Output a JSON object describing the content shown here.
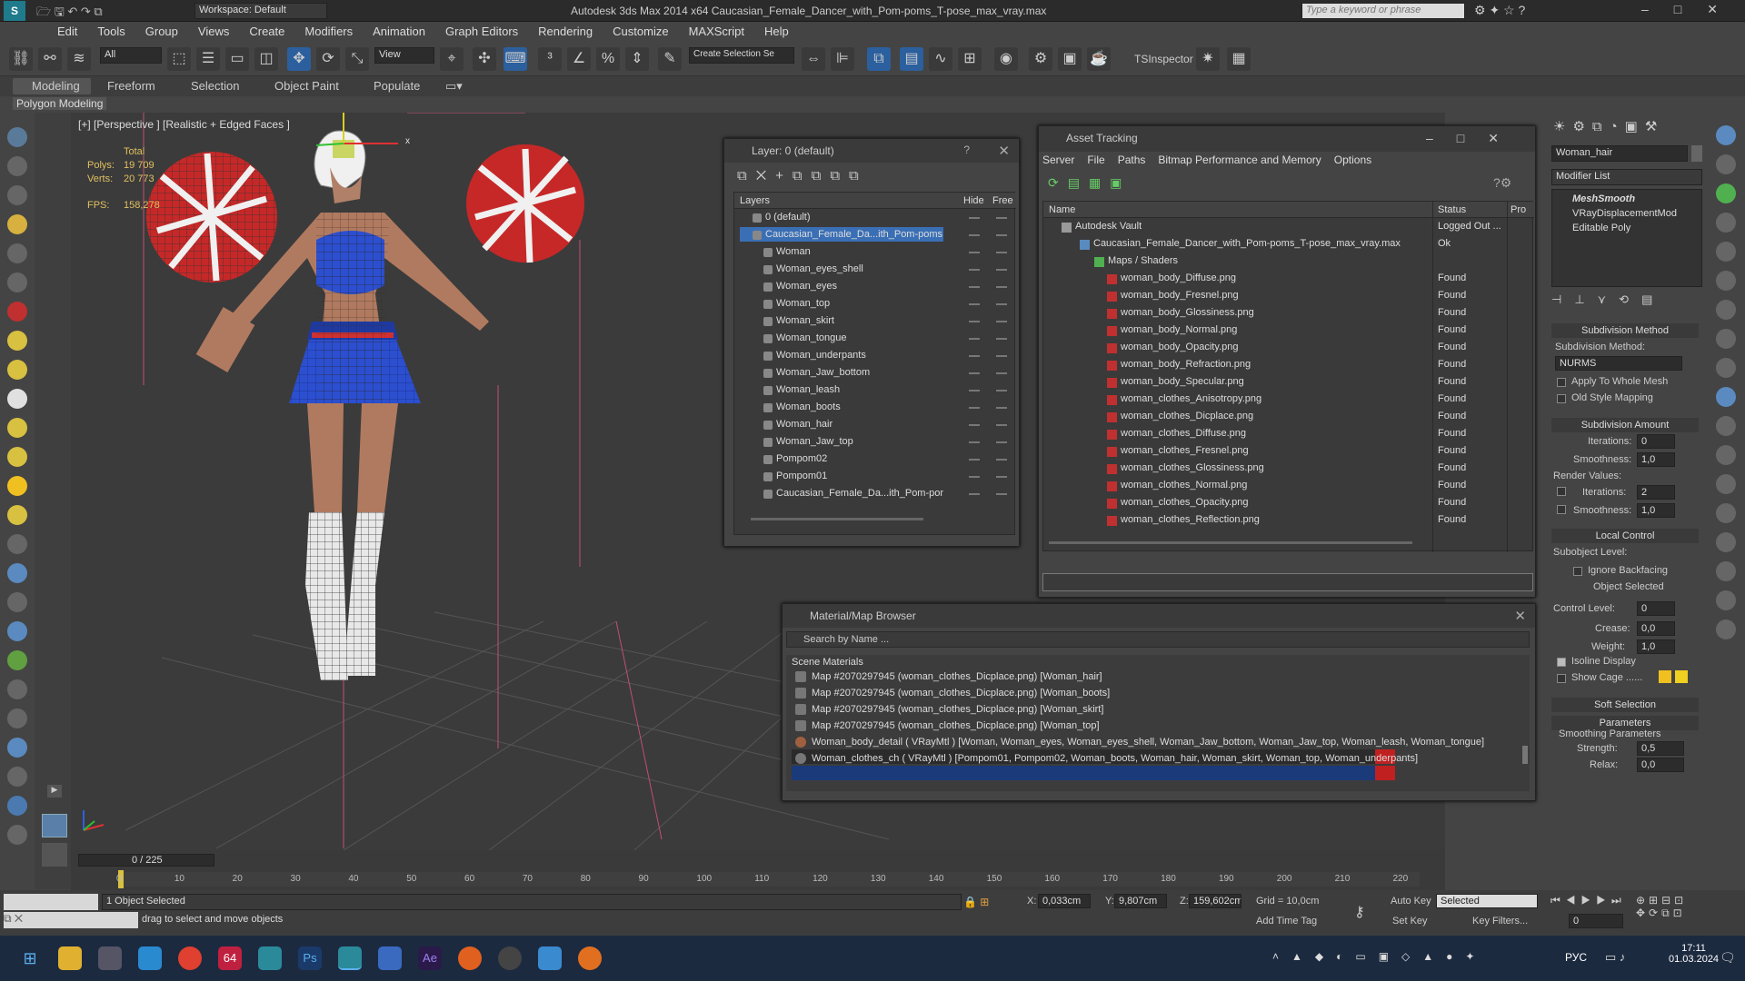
{
  "window": {
    "app_title": "Autodesk 3ds Max  2014 x64    Caucasian_Female_Dancer_with_Pom-poms_T-pose_max_vray.max",
    "workspace": "Workspace: Default",
    "search_placeholder": "Type a keyword or phrase"
  },
  "menu": [
    "Edit",
    "Tools",
    "Group",
    "Views",
    "Create",
    "Modifiers",
    "Animation",
    "Graph Editors",
    "Rendering",
    "Customize",
    "MAXScript",
    "Help"
  ],
  "toolbar": {
    "selection_filter": "All",
    "ref_coord": "View",
    "named_selection": "Create Selection Se",
    "ts_inspector": "TSInspector"
  },
  "ribbon": {
    "tabs": [
      "Modeling",
      "Freeform",
      "Selection",
      "Object Paint",
      "Populate"
    ],
    "sub": "Polygon Modeling"
  },
  "viewport": {
    "label": "[+] [Perspective ] [Realistic + Edged Faces ]",
    "stats_title": "Total",
    "polys_label": "Polys:",
    "polys": "19 709",
    "verts_label": "Verts:",
    "verts": "20 773",
    "fps_label": "FPS:",
    "fps": "158,278",
    "axis_x": "x"
  },
  "layer_panel": {
    "title": "Layer: 0 (default)",
    "help": "?",
    "col_layers": "Layers",
    "col_hide": "Hide",
    "col_freeze": "Free",
    "items": [
      "0 (default)",
      "Caucasian_Female_Da...ith_Pom-poms",
      "Woman",
      "Woman_eyes_shell",
      "Woman_eyes",
      "Woman_top",
      "Woman_skirt",
      "Woman_tongue",
      "Woman_underpants",
      "Woman_Jaw_bottom",
      "Woman_leash",
      "Woman_boots",
      "Woman_hair",
      "Woman_Jaw_top",
      "Pompom02",
      "Pompom01",
      "Caucasian_Female_Da...ith_Pom-por"
    ]
  },
  "asset_panel": {
    "title": "Asset Tracking",
    "menu": [
      "Server",
      "File",
      "Paths",
      "Bitmap Performance and Memory",
      "Options"
    ],
    "col_name": "Name",
    "col_status": "Status",
    "col_pro": "Pro",
    "rows": [
      {
        "name": "Autodesk Vault",
        "status": "Logged Out ..."
      },
      {
        "name": "Caucasian_Female_Dancer_with_Pom-poms_T-pose_max_vray.max",
        "status": "Ok"
      },
      {
        "name": "Maps / Shaders",
        "status": ""
      },
      {
        "name": "woman_body_Diffuse.png",
        "status": "Found"
      },
      {
        "name": "woman_body_Fresnel.png",
        "status": "Found"
      },
      {
        "name": "woman_body_Glossiness.png",
        "status": "Found"
      },
      {
        "name": "woman_body_Normal.png",
        "status": "Found"
      },
      {
        "name": "woman_body_Opacity.png",
        "status": "Found"
      },
      {
        "name": "woman_body_Refraction.png",
        "status": "Found"
      },
      {
        "name": "woman_body_Specular.png",
        "status": "Found"
      },
      {
        "name": "woman_clothes_Anisotropy.png",
        "status": "Found"
      },
      {
        "name": "woman_clothes_Dicplace.png",
        "status": "Found"
      },
      {
        "name": "woman_clothes_Diffuse.png",
        "status": "Found"
      },
      {
        "name": "woman_clothes_Fresnel.png",
        "status": "Found"
      },
      {
        "name": "woman_clothes_Glossiness.png",
        "status": "Found"
      },
      {
        "name": "woman_clothes_Normal.png",
        "status": "Found"
      },
      {
        "name": "woman_clothes_Opacity.png",
        "status": "Found"
      },
      {
        "name": "woman_clothes_Reflection.png",
        "status": "Found"
      }
    ]
  },
  "material_panel": {
    "title": "Material/Map Browser",
    "search_placeholder": "Search by Name ...",
    "section": "Scene Materials",
    "rows": [
      "Map #2070297945 (woman_clothes_Dicplace.png)  [Woman_hair]",
      "Map #2070297945 (woman_clothes_Dicplace.png)  [Woman_boots]",
      "Map #2070297945 (woman_clothes_Dicplace.png)  [Woman_skirt]",
      "Map #2070297945 (woman_clothes_Dicplace.png)  [Woman_top]",
      "Woman_body_detail  ( VRayMtl ) [Woman, Woman_eyes, Woman_eyes_shell, Woman_Jaw_bottom, Woman_Jaw_top, Woman_leash, Woman_tongue]",
      "Woman_clothes_ch  ( VRayMtl ) [Pompom01, Pompom02, Woman_boots, Woman_hair, Woman_skirt, Woman_top, Woman_underpants]"
    ]
  },
  "command_panel": {
    "object_name": "Woman_hair",
    "modifier_list": "Modifier List",
    "stack": [
      "MeshSmooth",
      "VRayDisplacementMod",
      "Editable Poly"
    ],
    "subdiv_method_header": "Subdivision Method",
    "subdiv_method_label": "Subdivision Method:",
    "subdiv_method": "NURMS",
    "apply_whole": "Apply To Whole Mesh",
    "old_style": "Old Style Mapping",
    "subdiv_amount_header": "Subdivision Amount",
    "iterations_label": "Iterations:",
    "iterations": "0",
    "smoothness_label": "Smoothness:",
    "smoothness": "1,0",
    "render_values": "Render Values:",
    "render_iterations": "2",
    "render_smoothness": "1,0",
    "local_control_header": "Local Control",
    "subobject_level": "Subobject Level:",
    "ignore_backfacing": "Ignore Backfacing",
    "object_selected": "Object Selected",
    "control_level_label": "Control Level:",
    "control_level": "0",
    "crease_label": "Crease:",
    "crease": "0,0",
    "weight_label": "Weight:",
    "weight": "1,0",
    "isoline": "Isoline Display",
    "show_cage": "Show Cage ......",
    "soft_selection": "Soft Selection",
    "parameters": "Parameters",
    "smoothing_params": "Smoothing Parameters",
    "strength_label": "Strength:",
    "strength": "0,5",
    "relax_label": "Relax:",
    "relax": "0,0"
  },
  "timeline": {
    "frame": "0 / 225",
    "ticks": [
      "0",
      "10",
      "20",
      "30",
      "40",
      "50",
      "60",
      "70",
      "80",
      "90",
      "100",
      "110",
      "120",
      "130",
      "140",
      "150",
      "160",
      "170",
      "180",
      "190",
      "200",
      "210",
      "220"
    ]
  },
  "status": {
    "selected": "1 Object Selected",
    "hint": "drag to select and move objects",
    "x_label": "X:",
    "x": "0,033cm",
    "y_label": "Y:",
    "y": "9,807cm",
    "z_label": "Z:",
    "z": "159,602cm",
    "grid": "Grid = 10,0cm",
    "add_time_tag": "Add Time Tag",
    "auto_key": "Auto Key",
    "selected_dd": "Selected",
    "set_key": "Set Key",
    "key_filters": "Key Filters...",
    "frame_field": "0"
  },
  "taskbar": {
    "lang": "РУС",
    "time": "17:11",
    "date": "01.03.2024",
    "badge64": "64"
  },
  "colors": {
    "accent": "#2b5f9e",
    "found": "#ddd",
    "selection": "#3a6fb5"
  }
}
